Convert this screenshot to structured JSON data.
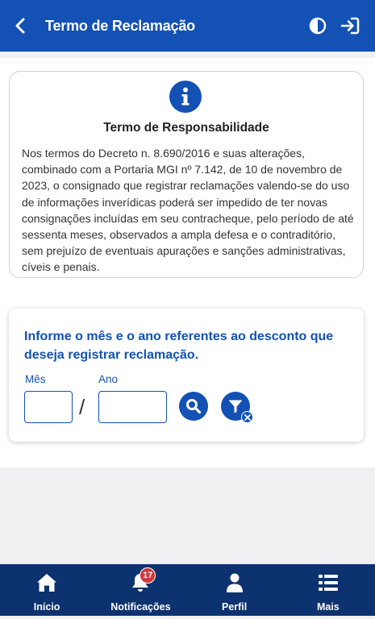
{
  "header": {
    "title": "Termo de Reclamação",
    "back_icon": "chevron-left-icon",
    "contrast_icon": "contrast-icon",
    "login_icon": "sign-in-icon",
    "color": "#1351b4"
  },
  "notice": {
    "icon": "info-icon",
    "title": "Termo de Responsabilidade",
    "body": "Nos termos do Decreto n. 8.690/2016 e suas alterações, combinado com a Portaria MGI nº 7.142, de 10 de novembro de 2023, o consignado que registrar reclamações valendo-se do uso de informações inverídicas poderá ser impedido de ter novas consignações incluídas em seu contracheque, pelo período de até sessenta meses, observados a ampla defesa e o contraditório, sem prejuízo de eventuais apurações e sanções administrativas, cíveis e penais."
  },
  "form": {
    "prompt": "Informe o mês e o ano referentes ao desconto que deseja registrar reclamação.",
    "month_label": "Mês",
    "year_label": "Ano",
    "month_value": "",
    "year_value": "",
    "separator": "/",
    "search_icon": "search-icon",
    "clear_filter_icon": "filter-clear-icon"
  },
  "nav": {
    "items": [
      {
        "label": "Início",
        "icon": "home-icon"
      },
      {
        "label": "Notificações",
        "icon": "bell-icon",
        "badge": "17"
      },
      {
        "label": "Perfil",
        "icon": "user-icon"
      },
      {
        "label": "Mais",
        "icon": "list-icon"
      }
    ],
    "color": "#0c326f",
    "badge_color": "#d0363a"
  }
}
